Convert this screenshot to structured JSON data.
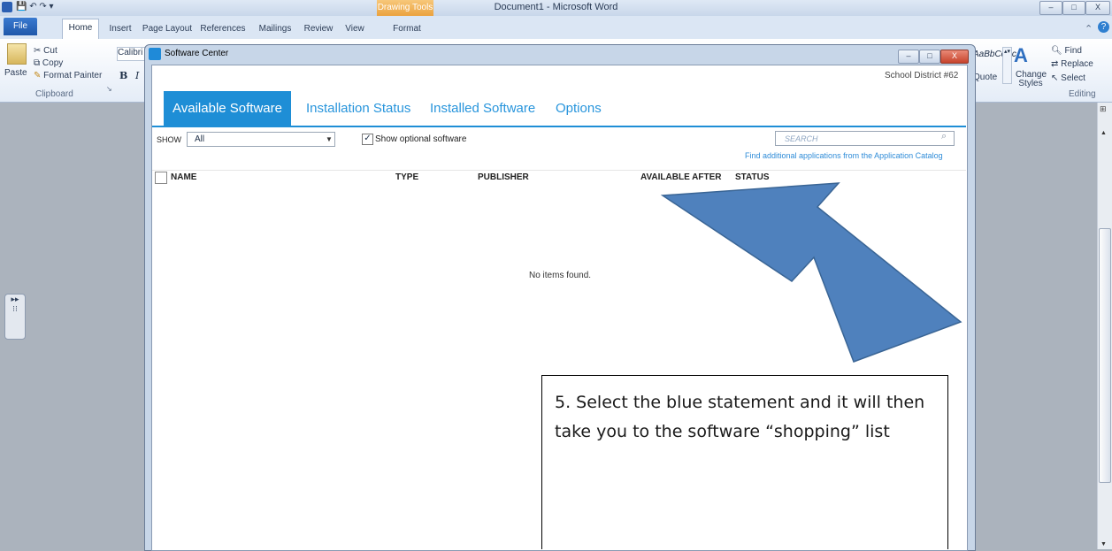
{
  "word": {
    "title": "Document1  -  Microsoft Word",
    "drawing_tools": "Drawing Tools",
    "window_buttons": [
      "–",
      "□",
      "X"
    ],
    "tabs": {
      "file": "File",
      "home": "Home",
      "insert": "Insert",
      "page_layout": "Page Layout",
      "references": "References",
      "mailings": "Mailings",
      "review": "Review",
      "view": "View",
      "format": "Format"
    },
    "clipboard": {
      "paste": "Paste",
      "cut": "Cut",
      "copy": "Copy",
      "format_painter": "Format Painter",
      "group_label": "Clipboard"
    },
    "font_box": "Calibri (",
    "bold": "B",
    "italic": "I",
    "styles": {
      "preview": "AaBbCcDc",
      "quote": "Quote",
      "change_styles": "Change Styles"
    },
    "editing": {
      "find": "Find",
      "replace": "Replace",
      "select": "Select",
      "group_label": "Editing"
    }
  },
  "software_center": {
    "title": "Software Center",
    "organization": "School District #62",
    "nav": [
      "Available Software",
      "Installation Status",
      "Installed Software",
      "Options"
    ],
    "show_label": "SHOW",
    "show_value": "All",
    "optional_label": "Show optional software",
    "search_placeholder": "SEARCH",
    "catalog_link": "Find additional applications from the Application Catalog",
    "columns": [
      "NAME",
      "TYPE",
      "PUBLISHER",
      "AVAILABLE AFTER",
      "STATUS"
    ],
    "empty_message": "No items found.",
    "colors": {
      "accent": "#1e8ed6",
      "link": "#2f8cd8"
    }
  },
  "annotation": {
    "text": "5. Select the blue statement and it will then take you to the software “shopping” list",
    "arrow_color": "#4f81bd"
  }
}
